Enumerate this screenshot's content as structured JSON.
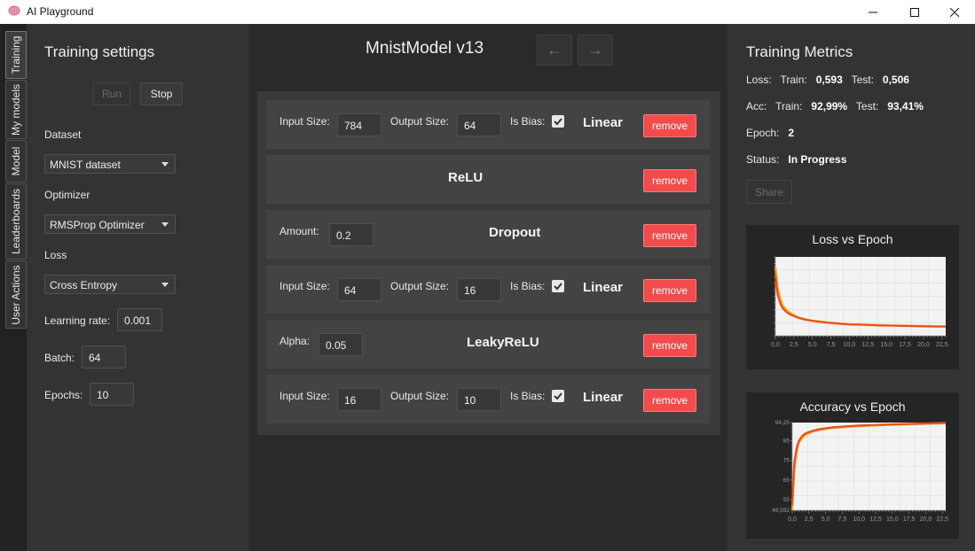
{
  "window": {
    "title": "AI Playground"
  },
  "tabs": [
    "Training",
    "My models",
    "Model",
    "Leaderboards",
    "User Actions"
  ],
  "settings": {
    "title": "Training settings",
    "run_label": "Run",
    "stop_label": "Stop",
    "dataset_label": "Dataset",
    "dataset_value": "MNIST dataset",
    "optimizer_label": "Optimizer",
    "optimizer_value": "RMSProp Optimizer",
    "loss_label": "Loss",
    "loss_value": "Cross Entropy",
    "lr_label": "Learning rate:",
    "lr_value": "0.001",
    "batch_label": "Batch:",
    "batch_value": "64",
    "epochs_label": "Epochs:",
    "epochs_value": "10"
  },
  "model": {
    "title": "MnistModel  v13",
    "prev_icon": "←",
    "next_icon": "→",
    "remove_label": "remove",
    "layers": [
      {
        "type": "Linear",
        "input_label": "Input Size:",
        "input": "784",
        "output_label": "Output Size:",
        "output": "64",
        "bias_label": "Is Bias:",
        "bias": true
      },
      {
        "type": "ReLU"
      },
      {
        "type": "Dropout",
        "param_label": "Amount:",
        "param": "0.2"
      },
      {
        "type": "Linear",
        "input_label": "Input Size:",
        "input": "64",
        "output_label": "Output Size:",
        "output": "16",
        "bias_label": "Is Bias:",
        "bias": true
      },
      {
        "type": "LeakyReLU",
        "param_label": "Alpha:",
        "param": "0.05"
      },
      {
        "type": "Linear",
        "input_label": "Input Size:",
        "input": "16",
        "output_label": "Output Size:",
        "output": "10",
        "bias_label": "Is Bias:",
        "bias": true
      }
    ]
  },
  "metrics": {
    "title": "Training Metrics",
    "loss_label": "Loss:",
    "acc_label": "Acc:",
    "train_label": "Train:",
    "test_label": "Test:",
    "loss_train": "0,593",
    "loss_test": "0,506",
    "acc_train": "92,99%",
    "acc_test": "93,41%",
    "epoch_label": "Epoch:",
    "epoch": "2",
    "status_label": "Status:",
    "status": "In Progress",
    "share_label": "Share"
  },
  "colors": {
    "accent": "#f24b4b",
    "line1": "#f7a21b",
    "line2": "#e8501d"
  },
  "chart_data": [
    {
      "type": "line",
      "title": "Loss vs Epoch",
      "x_ticks": [
        "0,0",
        "2,5",
        "5,0",
        "7,5",
        "10,0",
        "12,5",
        "15,0",
        "17,5",
        "20,0",
        "22,5"
      ],
      "xlim": [
        0,
        23
      ],
      "ylim": [
        0,
        2.6
      ],
      "series": [
        {
          "color": "#f7a21b",
          "x": [
            0,
            0.3,
            0.7,
            1,
            1.5,
            2,
            3,
            4,
            5,
            6,
            7,
            8,
            9,
            10,
            12,
            14,
            16,
            18,
            20,
            22,
            23
          ],
          "y": [
            2.3,
            1.6,
            1.2,
            1.0,
            0.85,
            0.75,
            0.62,
            0.55,
            0.5,
            0.47,
            0.44,
            0.42,
            0.4,
            0.38,
            0.37,
            0.35,
            0.34,
            0.33,
            0.32,
            0.31,
            0.31
          ]
        },
        {
          "color": "#e8501d",
          "x": [
            0,
            0.3,
            0.7,
            1,
            1.5,
            2,
            3,
            4,
            5,
            6,
            7,
            8,
            9,
            10,
            12,
            14,
            16,
            18,
            20,
            22,
            23
          ],
          "y": [
            2.0,
            1.35,
            1.05,
            0.9,
            0.78,
            0.7,
            0.6,
            0.53,
            0.49,
            0.46,
            0.43,
            0.41,
            0.39,
            0.37,
            0.36,
            0.34,
            0.33,
            0.32,
            0.31,
            0.3,
            0.3
          ]
        }
      ]
    },
    {
      "type": "line",
      "title": "Accuracy vs Epoch",
      "y_ticks": [
        "94,25",
        "85",
        "75",
        "65",
        "55",
        "49,592"
      ],
      "x_ticks": [
        "0,0",
        "2,5",
        "5,0",
        "7,5",
        "10,0",
        "12,5",
        "15,0",
        "17,5",
        "20,0",
        "22,5"
      ],
      "xlim": [
        0,
        23
      ],
      "ylim": [
        49.592,
        94.25
      ],
      "series": [
        {
          "color": "#f7a21b",
          "x": [
            0,
            0.3,
            0.7,
            1,
            1.5,
            2,
            3,
            4,
            5,
            6,
            8,
            10,
            12,
            14,
            16,
            18,
            20,
            22,
            23
          ],
          "y": [
            50,
            70,
            80,
            84,
            86.5,
            88,
            89.5,
            90.5,
            91,
            91.5,
            92,
            92.4,
            92.7,
            93,
            93.2,
            93.4,
            93.6,
            93.8,
            93.9
          ]
        },
        {
          "color": "#e8501d",
          "x": [
            0,
            0.3,
            0.7,
            1,
            1.5,
            2,
            3,
            4,
            5,
            6,
            8,
            10,
            12,
            14,
            16,
            18,
            20,
            22,
            23
          ],
          "y": [
            52,
            74,
            82,
            85,
            87.5,
            88.8,
            90,
            90.8,
            91.3,
            91.8,
            92.3,
            92.7,
            93,
            93.2,
            93.4,
            93.6,
            93.8,
            94,
            94.1
          ]
        }
      ]
    }
  ]
}
